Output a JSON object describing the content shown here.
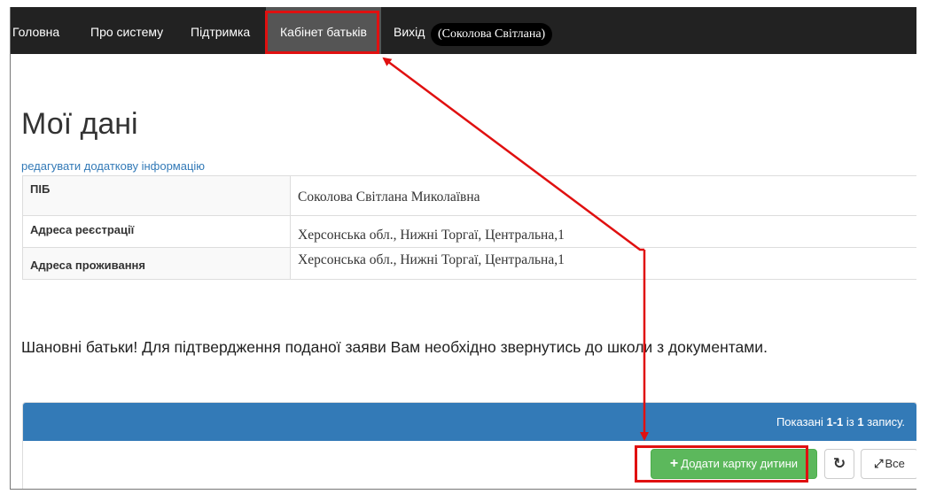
{
  "navbar": {
    "items": [
      {
        "label": "Головна"
      },
      {
        "label": "Про систему"
      },
      {
        "label": "Підтримка"
      },
      {
        "label": "Кабінет батьків",
        "active": true
      },
      {
        "label": "Вихід"
      }
    ],
    "user": "(Соколова Світлана)"
  },
  "main": {
    "title": "Мої дані",
    "edit_link": "редагувати додаткову інформацію",
    "rows": [
      {
        "label": "ПІБ",
        "value": "Соколова Світлана Миколаївна"
      },
      {
        "label": "Адреса реєстрації",
        "value": "Херсонська обл., Нижні Торгаї, Центральна,1"
      },
      {
        "label": "Адреса проживання",
        "value": "Херсонська обл., Нижні Торгаї, Центральна,1"
      }
    ],
    "notice": "Шановні батьки! Для підтвердження поданої заяви Вам необхідно звернутись до школи з документами."
  },
  "grid": {
    "summary_prefix": "Показані ",
    "summary_range": "1-1",
    "summary_mid": " із ",
    "summary_total": "1",
    "summary_suffix": " запису.",
    "add_button": "Додати картку дитини",
    "all_button": "Все"
  },
  "icons": {
    "add": "plus-icon",
    "refresh": "refresh-icon",
    "all": "expand-icon"
  },
  "colors": {
    "navbar_bg": "#222222",
    "navbar_active": "#555555",
    "highlight": "#e01010",
    "panel_header": "#337ab7",
    "add_button": "#5cb85c",
    "link": "#337ab7"
  }
}
